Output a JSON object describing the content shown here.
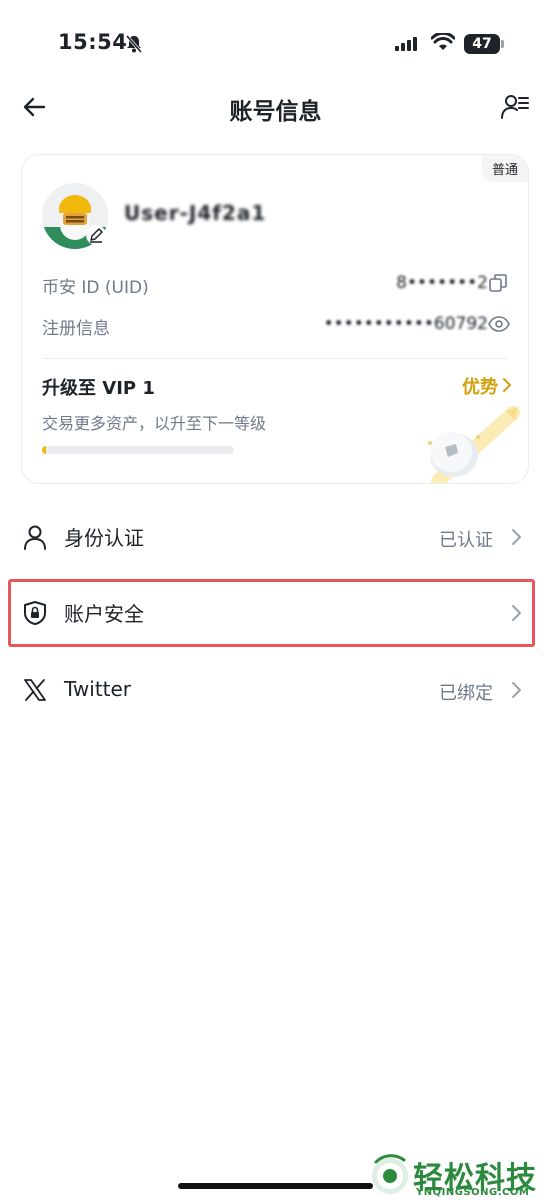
{
  "status_bar": {
    "time": "15:54",
    "battery": "47"
  },
  "header": {
    "title": "账号信息"
  },
  "profile_card": {
    "badge": "普通",
    "username": "User-J4f2a1",
    "uid_label": "币安 ID (UID)",
    "uid_value": "8•••••••2",
    "reg_label": "注册信息",
    "reg_value": "•••••••••••60792",
    "vip_title": "升级至 VIP 1",
    "vip_link": "优势",
    "vip_subtitle": "交易更多资产，以升至下一等级",
    "vip_progress": 0.02
  },
  "menu": [
    {
      "label": "身份认证",
      "status": "已认证",
      "icon": "person-icon"
    },
    {
      "label": "账户安全",
      "status": "",
      "icon": "shield-lock-icon"
    },
    {
      "label": "Twitter",
      "status": "已绑定",
      "icon": "x-logo-icon"
    }
  ],
  "watermark": {
    "text": "轻松科技",
    "sub": "YNQINGSONG.COM"
  },
  "colors": {
    "accent": "#F0B90B",
    "link_gold": "#D0A10B",
    "highlight": "#E8565D"
  }
}
